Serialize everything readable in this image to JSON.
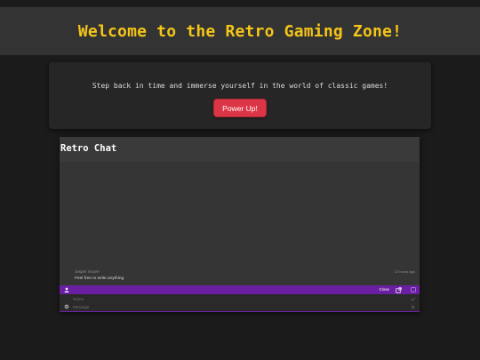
{
  "header": {
    "title": "Welcome to the Retro Gaming Zone!"
  },
  "intro": {
    "text": "Step back in time and immerse yourself in the world of classic games!",
    "button_label": "Power Up!"
  },
  "chat": {
    "title": "Retro Chat",
    "messages": [
      {
        "author": "Jasper moore",
        "time": "12 hours ago",
        "text": "Feel free to write anything"
      }
    ],
    "bar": {
      "close_label": "Close"
    },
    "form": {
      "name_placeholder": "Name",
      "message_placeholder": "Message"
    }
  },
  "icons": {
    "user": "user-icon",
    "popout": "external-link-icon",
    "settings": "settings-icon",
    "smiley": "smiley-icon"
  },
  "colors": {
    "title": "#f5c518",
    "button": "#dc3545",
    "chat_bar": "#6a1fa2"
  }
}
